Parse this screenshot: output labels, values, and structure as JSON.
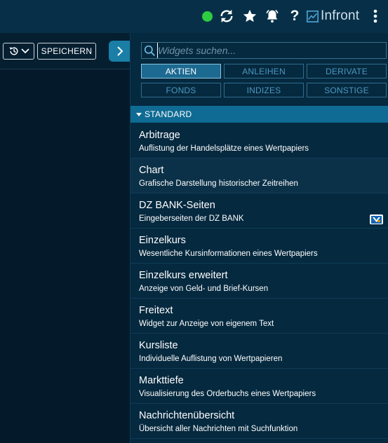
{
  "topbar": {
    "status_color": "#2ecc40",
    "brand": "Infront",
    "help_label": "?"
  },
  "left_toolbar": {
    "save_label": "SPEICHERN"
  },
  "widget_panel": {
    "search_placeholder": "Widgets suchen...",
    "categories": [
      {
        "label": "AKTIEN",
        "active": true
      },
      {
        "label": "ANLEIHEN",
        "active": false
      },
      {
        "label": "DERIVATE",
        "active": false
      },
      {
        "label": "FONDS",
        "active": false
      },
      {
        "label": "INDIZES",
        "active": false
      },
      {
        "label": "SONSTIGE",
        "active": false
      }
    ],
    "section_title": "STANDARD",
    "items": [
      {
        "name": "Arbitrage",
        "desc": "Auflistung der Handelsplätze eines Wertpapiers"
      },
      {
        "name": "Chart",
        "desc": "Grafische Darstellung historischer Zeitreihen"
      },
      {
        "name": "DZ BANK-Seiten",
        "desc": "Eingeberseiten der DZ BANK",
        "badge": "dz-bank-logo-icon"
      },
      {
        "name": "Einzelkurs",
        "desc": "Wesentliche Kursinformationen eines Wertpapiers"
      },
      {
        "name": "Einzelkurs erweitert",
        "desc": "Anzeige von Geld- und Brief-Kursen"
      },
      {
        "name": "Freitext",
        "desc": "Widget zur Anzeige von eigenem Text"
      },
      {
        "name": "Kursliste",
        "desc": "Individuelle Auflistung von Wertpapieren"
      },
      {
        "name": "Markttiefe",
        "desc": "Visualisierung des Orderbuchs eines Wertpapiers"
      },
      {
        "name": "Nachrichtenübersicht",
        "desc": "Übersicht aller Nachrichten mit Suchfunktion"
      }
    ]
  }
}
